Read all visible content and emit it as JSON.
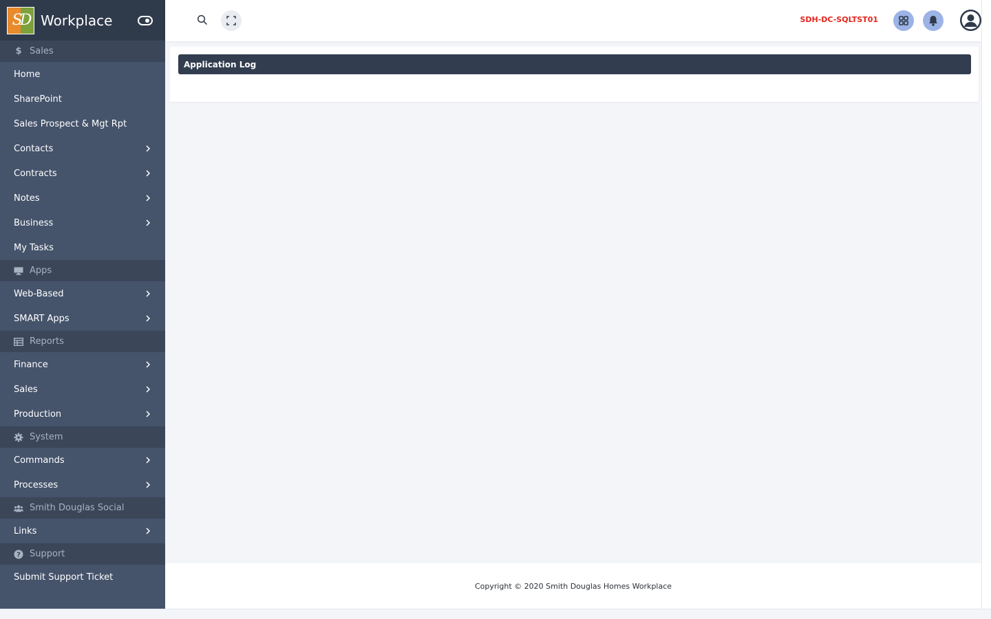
{
  "brand": {
    "name": "Workplace",
    "logo_text": "SD"
  },
  "sidebar": {
    "sections": [
      {
        "title": "Sales",
        "icon": "dollar-icon",
        "items": [
          {
            "label": "Home",
            "has_children": false
          },
          {
            "label": "SharePoint",
            "has_children": false
          },
          {
            "label": "Sales Prospect & Mgt Rpt",
            "has_children": false
          },
          {
            "label": "Contacts",
            "has_children": true
          },
          {
            "label": "Contracts",
            "has_children": true
          },
          {
            "label": "Notes",
            "has_children": true
          },
          {
            "label": "Business",
            "has_children": true
          },
          {
            "label": "My Tasks",
            "has_children": false
          }
        ]
      },
      {
        "title": "Apps",
        "icon": "desktop-icon",
        "items": [
          {
            "label": "Web-Based",
            "has_children": true
          },
          {
            "label": "SMART Apps",
            "has_children": true
          }
        ]
      },
      {
        "title": "Reports",
        "icon": "table-icon",
        "items": [
          {
            "label": "Finance",
            "has_children": true
          },
          {
            "label": "Sales",
            "has_children": true
          },
          {
            "label": "Production",
            "has_children": true
          }
        ]
      },
      {
        "title": "System",
        "icon": "gear-icon",
        "items": [
          {
            "label": "Commands",
            "has_children": true
          },
          {
            "label": "Processes",
            "has_children": true
          }
        ]
      },
      {
        "title": "Smith Douglas Social",
        "icon": "users-icon",
        "items": [
          {
            "label": "Links",
            "has_children": true
          }
        ]
      },
      {
        "title": "Support",
        "icon": "question-icon",
        "items": [
          {
            "label": "Submit Support Ticket",
            "has_children": false
          }
        ]
      }
    ]
  },
  "topbar": {
    "server_name": "SDH-DC-SQLTST01",
    "icons": [
      "search-icon",
      "fullscreen-icon",
      "apps-grid-icon",
      "bell-icon",
      "user-icon"
    ]
  },
  "main": {
    "card_title": "Application Log"
  },
  "footer": {
    "copyright": "Copyright © 2020 Smith Douglas Homes Workplace"
  },
  "colors": {
    "sidebar_bg": "#45536b",
    "sidebar_section_bg": "#3b4659",
    "brand_bg": "#2f3a4b",
    "server_name": "#e3241b",
    "accent_button": "#9cb3e6",
    "card_header": "#323d4f"
  }
}
